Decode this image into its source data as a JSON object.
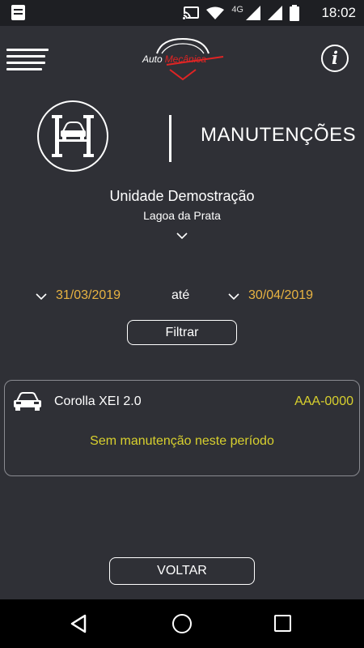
{
  "status_bar": {
    "time": "18:02",
    "network": "4G",
    "icons": [
      "notification-icon",
      "cast-icon",
      "wifi-icon",
      "signal-icon",
      "battery-icon"
    ]
  },
  "header": {
    "logo_text_1": "Auto",
    "logo_text_2": "Mecânica",
    "icons": [
      "menu-icon",
      "info-icon"
    ]
  },
  "page": {
    "title": "MANUTENÇÕES",
    "icon": "car-lift-icon"
  },
  "unit": {
    "name": "Unidade Demostração",
    "city": "Lagoa da Prata"
  },
  "filter": {
    "start_date": "31/03/2019",
    "separator": "até",
    "end_date": "30/04/2019",
    "button_label": "Filtrar"
  },
  "vehicle": {
    "model": "Corolla XEI 2.0",
    "plate": "AAA-0000",
    "message": "Sem manutenção neste período"
  },
  "back_button_label": "VOLTAR",
  "colors": {
    "background": "#2f3036",
    "date_accent": "#e8b342",
    "plate_accent": "#d8d02e",
    "logo_red": "#e02424"
  }
}
